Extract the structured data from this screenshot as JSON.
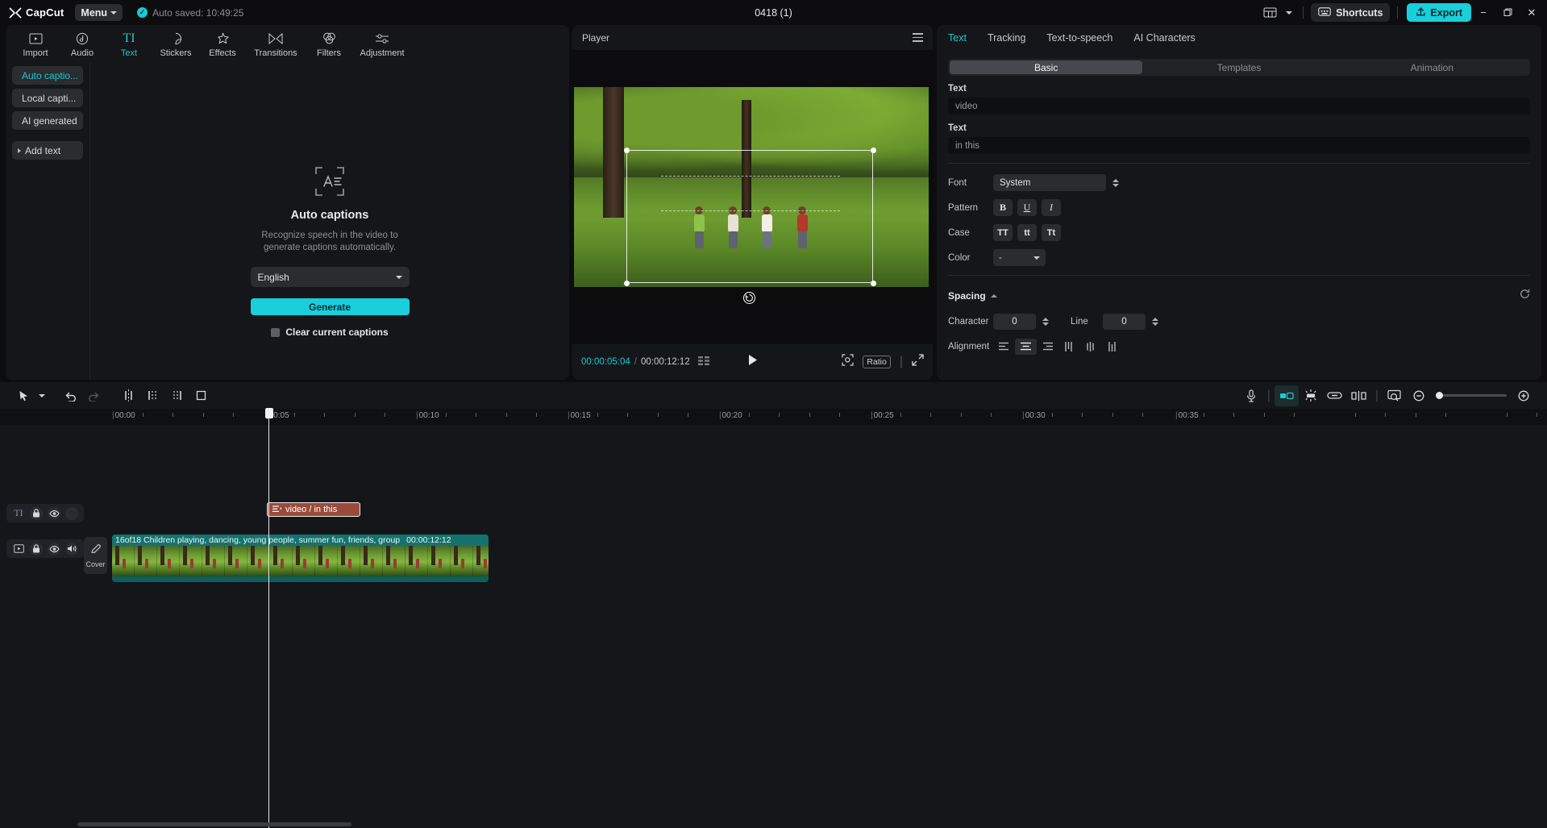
{
  "titlebar": {
    "app_name": "CapCut",
    "menu_label": "Menu",
    "autosave_text": "Auto saved: 10:49:25",
    "project_title": "0418 (1)",
    "shortcuts_label": "Shortcuts",
    "export_label": "Export",
    "layout_icon": "layout-icon",
    "shortcuts_icon": "keyboard-icon",
    "export_icon": "upload-icon",
    "minimize_icon": "minimize-icon",
    "maximize_icon": "maximize-icon",
    "close_icon": "close-icon",
    "accent": "#19cfdb"
  },
  "tool_tabs": [
    {
      "label": "Import",
      "icon": "media-import-icon",
      "active": false
    },
    {
      "label": "Audio",
      "icon": "audio-note-icon",
      "active": false
    },
    {
      "label": "Text",
      "icon": "text-TI-icon",
      "active": true
    },
    {
      "label": "Stickers",
      "icon": "sticker-icon",
      "active": false
    },
    {
      "label": "Effects",
      "icon": "effects-sparkle-icon",
      "active": false
    },
    {
      "label": "Transitions",
      "icon": "transitions-icon",
      "active": false
    },
    {
      "label": "Filters",
      "icon": "filters-icon",
      "active": false
    },
    {
      "label": "Adjustment",
      "icon": "adjustment-sliders-icon",
      "active": false
    }
  ],
  "text_sidebar": {
    "items": [
      {
        "label": "Auto captio...",
        "selected": true
      },
      {
        "label": "Local capti...",
        "selected": false
      },
      {
        "label": "AI generated",
        "selected": false
      }
    ],
    "add_text": {
      "label": "Add text",
      "icon": "triangle-right-icon"
    }
  },
  "auto_captions": {
    "icon": "auto-captions-icon",
    "title": "Auto captions",
    "description_line1": "Recognize speech in the video to",
    "description_line2": "generate captions automatically.",
    "language": "English",
    "language_chevron": "chevron-down-icon",
    "generate_label": "Generate",
    "clear_label": "Clear current captions",
    "clear_checked": false
  },
  "player": {
    "title": "Player",
    "menu_icon": "hamburger-icon",
    "current_time": "00:00:05:04",
    "separator": "/",
    "total_time": "00:00:12:12",
    "frames_icon": "frames-icon",
    "play_icon": "play-icon",
    "fit_icon": "fit-to-screen-icon",
    "ratio_label": "Ratio",
    "fullscreen_icon": "fullscreen-icon",
    "rotate_icon": "rotate-handle-icon"
  },
  "inspector": {
    "tabs": [
      {
        "label": "Text",
        "active": true
      },
      {
        "label": "Tracking",
        "active": false
      },
      {
        "label": "Text-to-speech",
        "active": false
      },
      {
        "label": "AI Characters",
        "active": false
      }
    ],
    "segments": [
      {
        "label": "Basic",
        "active": true
      },
      {
        "label": "Templates",
        "active": false
      },
      {
        "label": "Animation",
        "active": false
      }
    ],
    "text_field_1": {
      "label": "Text",
      "value": "video"
    },
    "text_field_2": {
      "label": "Text",
      "value": "in this"
    },
    "font": {
      "label": "Font",
      "value": "System",
      "spinner_icon": "spinner-icon"
    },
    "pattern": {
      "label": "Pattern",
      "buttons": [
        {
          "label": "B",
          "name": "bold"
        },
        {
          "label": "U",
          "name": "underline"
        },
        {
          "label": "I",
          "name": "italic"
        }
      ]
    },
    "case": {
      "label": "Case",
      "buttons": [
        {
          "label": "TT",
          "name": "uppercase"
        },
        {
          "label": "tt",
          "name": "lowercase"
        },
        {
          "label": "Tt",
          "name": "capitalize"
        }
      ]
    },
    "color": {
      "label": "Color",
      "value": "-",
      "chevron": "chevron-down-icon"
    },
    "spacing": {
      "title": "Spacing",
      "collapse_icon": "chevron-up-icon",
      "reset_icon": "reset-icon",
      "character_label": "Character",
      "character_value": "0",
      "line_label": "Line",
      "line_value": "0"
    },
    "alignment": {
      "label": "Alignment",
      "buttons": [
        {
          "name": "align-left-icon",
          "active": false
        },
        {
          "name": "align-center-icon",
          "active": true
        },
        {
          "name": "align-right-icon",
          "active": false
        },
        {
          "name": "align-vertical-top-icon",
          "active": false
        },
        {
          "name": "align-vertical-center-icon",
          "active": false
        },
        {
          "name": "align-vertical-bottom-icon",
          "active": false
        }
      ]
    }
  },
  "timeline": {
    "tools_left": [
      {
        "name": "select-arrow-icon",
        "disabled": false
      },
      {
        "name": "chevron-down-icon",
        "disabled": false
      },
      {
        "name": "undo-icon",
        "disabled": false
      },
      {
        "name": "redo-icon",
        "disabled": true
      },
      {
        "name": "split-icon",
        "disabled": false
      },
      {
        "name": "trim-left-icon",
        "disabled": false
      },
      {
        "name": "trim-right-icon",
        "disabled": false
      },
      {
        "name": "crop-icon",
        "disabled": false
      }
    ],
    "tools_right": [
      {
        "name": "microphone-icon",
        "toggled": false
      },
      {
        "name": "magnet-snap-icon",
        "toggled": true
      },
      {
        "name": "keyframe-icon",
        "toggled": false
      },
      {
        "name": "link-icon",
        "toggled": false
      },
      {
        "name": "split-clip-icon",
        "toggled": false
      },
      {
        "name": "zoom-fit-icon",
        "toggled": false
      },
      {
        "name": "zoom-out-icon",
        "toggled": false
      },
      {
        "name": "zoom-in-icon",
        "toggled": false
      }
    ],
    "ruler_labels": [
      "00:00",
      "00:05",
      "00:10",
      "00:15",
      "00:20",
      "00:25",
      "00:30",
      "00:35"
    ],
    "playhead_time": "00:05",
    "text_track": {
      "header_icons": [
        "text-TI-icon",
        "lock-icon",
        "eye-icon",
        "mute-placeholder-icon"
      ],
      "clip_icon": "caption-icon",
      "clip_label": "video / in this"
    },
    "video_track": {
      "header_icons": [
        "video-icon",
        "lock-icon",
        "eye-icon",
        "volume-icon"
      ],
      "cover_label": "Cover",
      "cover_icon": "pencil-icon",
      "clip_name": "16of18 Children playing, dancing, young people, summer fun, friends, group",
      "clip_duration": "00:00:12:12"
    }
  }
}
